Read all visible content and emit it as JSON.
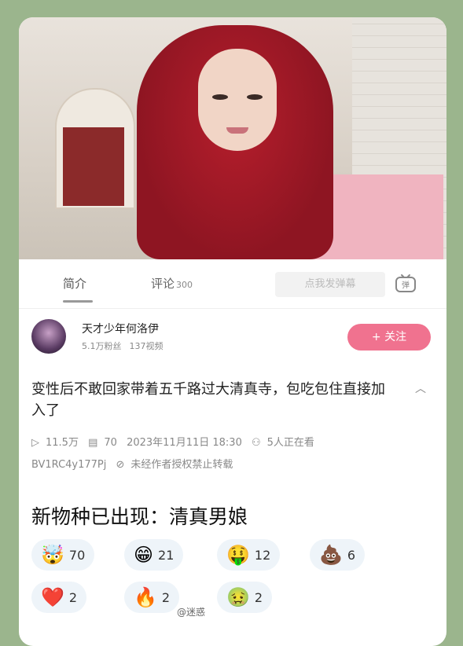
{
  "tabs": {
    "intro": "简介",
    "comments": "评论",
    "comments_count": "300",
    "danmaku_placeholder": "点我发弹幕"
  },
  "author": {
    "name": "天才少年何洛伊",
    "followers": "5.1万粉丝",
    "videos": "137视频",
    "follow_label": "+ 关注"
  },
  "video": {
    "title": "变性后不敢回家带着五千路过大清真寺，包吃包住直接加入了",
    "views": "11.5万",
    "danmaku_count": "70",
    "datetime": "2023年11月11日 18:30",
    "watching": "5人正在看",
    "bvid": "BV1RC4y177Pj",
    "copyright_note": "未经作者授权禁止转载"
  },
  "post": {
    "caption": "新物种已出现：清真男娘"
  },
  "reactions": [
    {
      "icon": "exploding-head",
      "glyph": "🤯",
      "count": "70"
    },
    {
      "icon": "grinning-face",
      "glyph": "😁",
      "count": "21"
    },
    {
      "icon": "money-face",
      "glyph": "🤑",
      "count": "12"
    },
    {
      "icon": "poo",
      "glyph": "💩",
      "count": "6"
    },
    {
      "icon": "red-heart",
      "glyph": "❤️",
      "count": "2"
    },
    {
      "icon": "fire",
      "glyph": "🔥",
      "count": "2"
    },
    {
      "icon": "nauseated-face",
      "glyph": "🤢",
      "count": "2"
    }
  ],
  "watermark": "@迷惑"
}
